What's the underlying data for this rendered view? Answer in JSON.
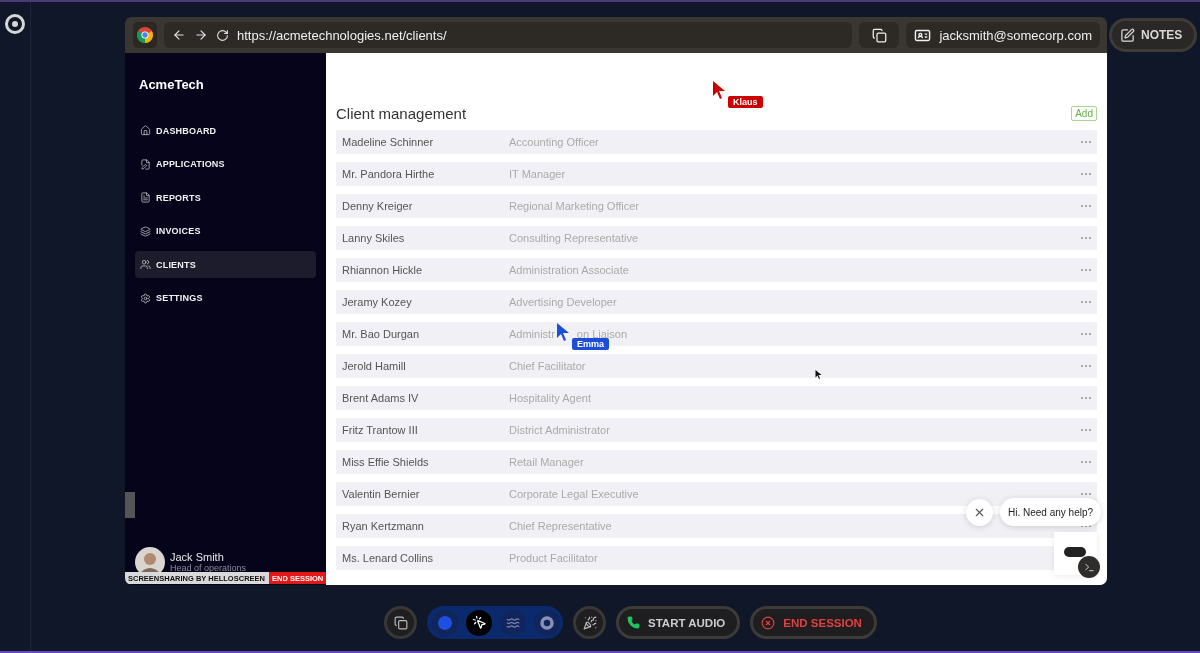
{
  "browser": {
    "url": "https://acmetechnologies.net/clients/",
    "account": "jacksmith@somecorp.com"
  },
  "notes_button": "NOTES",
  "sidebar": {
    "brand": "AcmeTech",
    "items": [
      {
        "label": "DASHBOARD",
        "kind": "home",
        "selected": false
      },
      {
        "label": "APPLICATIONS",
        "kind": "edit",
        "selected": false
      },
      {
        "label": "REPORTS",
        "kind": "report",
        "selected": false
      },
      {
        "label": "INVOICES",
        "kind": "stack",
        "selected": false
      },
      {
        "label": "CLIENTS",
        "kind": "people",
        "selected": true
      },
      {
        "label": "SETTINGS",
        "kind": "settings",
        "selected": false
      }
    ],
    "user": {
      "name": "Jack Smith",
      "role": "Head of operations"
    }
  },
  "page": {
    "title": "Client management",
    "add_button": "Add",
    "rows": [
      {
        "name": "Madeline Schinner",
        "role": "Accounting Officer"
      },
      {
        "name": "Mr. Pandora Hirthe",
        "role": "IT Manager"
      },
      {
        "name": "Denny Kreiger",
        "role": "Regional Marketing Officer"
      },
      {
        "name": "Lanny Skiles",
        "role": "Consulting Representative"
      },
      {
        "name": "Rhiannon Hickle",
        "role": "Administration Associate"
      },
      {
        "name": "Jeramy Kozey",
        "role": "Advertising Developer"
      },
      {
        "name": "Mr. Bao Durgan",
        "role_parts": [
          "Administr",
          "on Liaison"
        ]
      },
      {
        "name": "Jerold Hamill",
        "role": "Chief Facilitator"
      },
      {
        "name": "Brent Adams IV",
        "role": "Hospitality Agent"
      },
      {
        "name": "Fritz Trantow III",
        "role": "District Administrator"
      },
      {
        "name": "Miss Effie Shields",
        "role": "Retail Manager"
      },
      {
        "name": "Valentin Bernier",
        "role": "Corporate Legal Executive"
      },
      {
        "name": "Ryan Kertzmann",
        "role": "Chief Representative"
      },
      {
        "name": "Ms. Lenard Collins",
        "role": "Product Facilitator"
      }
    ]
  },
  "cursors": [
    {
      "name": "Klaus",
      "color": "#cc0000"
    },
    {
      "name": "Emma",
      "color": "#1d4ed8"
    }
  ],
  "chat": {
    "message": "Hi. Need any help?"
  },
  "share_banner": {
    "text": "SCREENSHARING BY HELLOSCREEN",
    "end": "END SESSION"
  },
  "toolbar": {
    "tools": [
      {
        "kind": "dot",
        "selected": false
      },
      {
        "kind": "pointer",
        "selected": true
      },
      {
        "kind": "draw",
        "selected": false
      },
      {
        "kind": "spotlight",
        "selected": false
      }
    ],
    "start_audio": "START AUDIO",
    "end_session": "END SESSION"
  }
}
